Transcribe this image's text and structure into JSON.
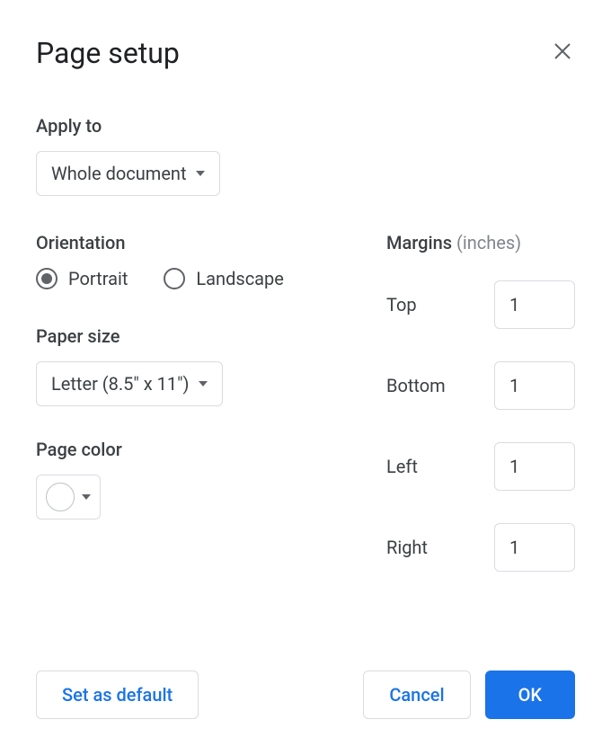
{
  "dialog": {
    "title": "Page setup"
  },
  "applyTo": {
    "label": "Apply to",
    "value": "Whole document"
  },
  "orientation": {
    "label": "Orientation",
    "options": {
      "portrait": "Portrait",
      "landscape": "Landscape"
    },
    "selected": "portrait"
  },
  "paperSize": {
    "label": "Paper size",
    "value": "Letter (8.5\" x 11\")"
  },
  "pageColor": {
    "label": "Page color",
    "value": "#ffffff"
  },
  "margins": {
    "label": "Margins",
    "unit": "(inches)",
    "top": {
      "label": "Top",
      "value": "1"
    },
    "bottom": {
      "label": "Bottom",
      "value": "1"
    },
    "left": {
      "label": "Left",
      "value": "1"
    },
    "right": {
      "label": "Right",
      "value": "1"
    }
  },
  "buttons": {
    "setDefault": "Set as default",
    "cancel": "Cancel",
    "ok": "OK"
  }
}
